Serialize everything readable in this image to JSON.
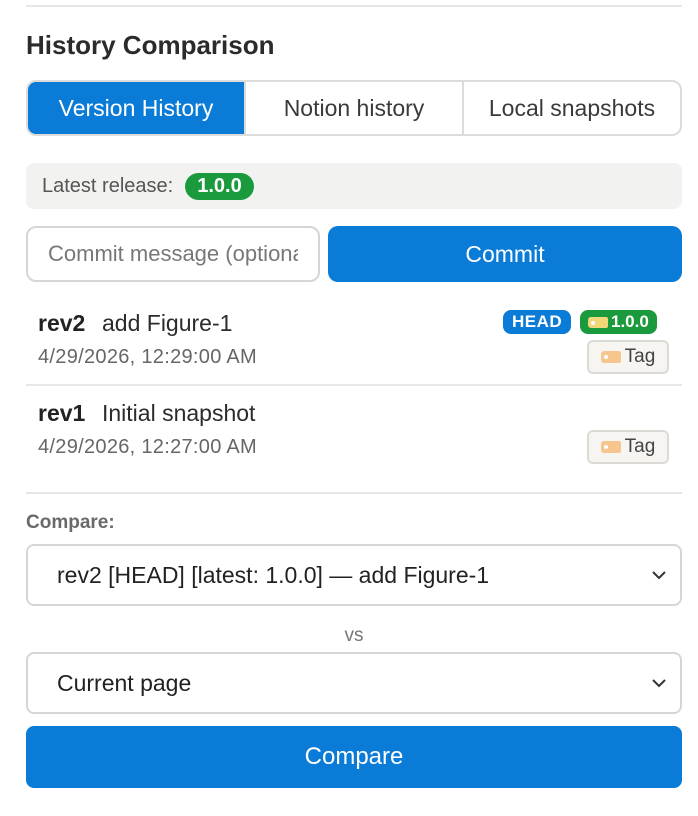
{
  "panel": {
    "title": "History Comparison",
    "tabs": [
      {
        "label": "Version History",
        "active": true
      },
      {
        "label": "Notion history",
        "active": false
      },
      {
        "label": "Local snapshots",
        "active": false
      }
    ]
  },
  "release": {
    "label": "Latest release:",
    "version": "1.0.0"
  },
  "commit": {
    "placeholder": "Commit message (optional)",
    "button_label": "Commit"
  },
  "revisions": [
    {
      "id": "rev2",
      "message": "add Figure-1",
      "timestamp": "4/29/2026, 12:29:00 AM",
      "head_badge": "HEAD",
      "version_badge": "1.0.0",
      "tag_label": "Tag"
    },
    {
      "id": "rev1",
      "message": "Initial snapshot",
      "timestamp": "4/29/2026, 12:27:00 AM",
      "tag_label": "Tag"
    }
  ],
  "compare": {
    "label": "Compare:",
    "left_selected": "rev2 [HEAD] [latest: 1.0.0] — add Figure-1",
    "vs": "vs",
    "right_selected": "Current page",
    "button_label": "Compare"
  },
  "colors": {
    "accent": "#0a7bd6",
    "release_green": "#1a9a3c"
  },
  "icons": {
    "tag": "tag-icon",
    "dropdown": "chevron-down-icon"
  }
}
